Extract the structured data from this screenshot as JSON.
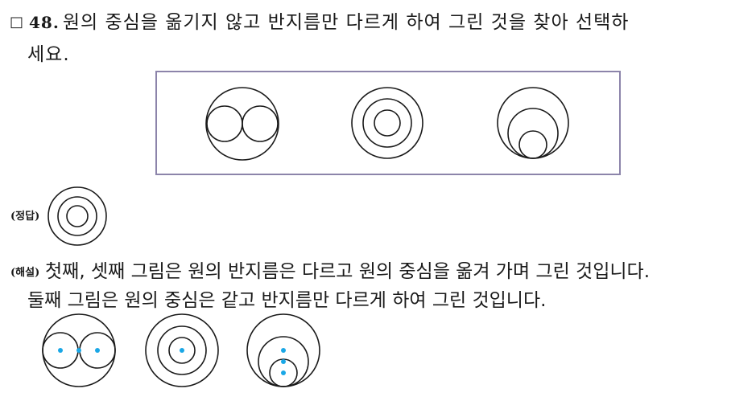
{
  "question": {
    "checkbox": "□",
    "number": "48.",
    "text_line1": "원의 중심을 옮기지 않고 반지름만 다르게 하여 그린 것을 찾아 선택하",
    "text_line2": "세요."
  },
  "answer": {
    "tag": "(정답)"
  },
  "explanation": {
    "tag": "(해설)",
    "line1": "첫째, 셋째 그림은 원의 반지름은 다르고 원의 중심을 옮겨 가며 그린 것입니다.",
    "line2": "둘째 그림은 원의 중심은 같고 반지름만 다르게 하여 그린 것입니다."
  },
  "colors": {
    "box_border": "#8c84aa",
    "line": "#1a1a1a",
    "center_dot": "#1aa7e6"
  }
}
